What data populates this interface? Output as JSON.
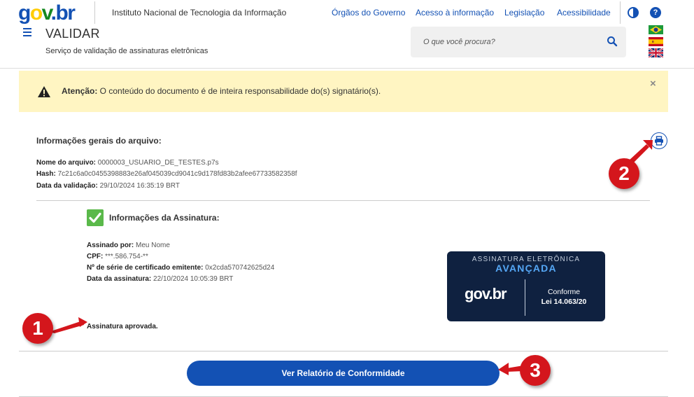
{
  "header": {
    "logo_text": "gov.br",
    "org_name": "Instituto Nacional de Tecnologia da Informação",
    "links": [
      "Órgãos do Governo",
      "Acesso à informação",
      "Legislação",
      "Acessibilidade"
    ],
    "app_title": "VALIDAR",
    "app_subtitle": "Serviço de validação de assinaturas eletrônicas",
    "search_placeholder": "O que você procura?",
    "help_glyph": "?"
  },
  "alert": {
    "label": "Atenção:",
    "text": " O conteúdo do documento é de inteira responsabilidade do(s) signatário(s).",
    "close": "×"
  },
  "file_info": {
    "title": "Informações gerais do arquivo:",
    "fields": [
      {
        "key": "Nome do arquivo:",
        "value": "0000003_USUARIO_DE_TESTES.p7s"
      },
      {
        "key": "Hash:",
        "value": "7c21c6a0c0455398883e26af045039cd9041c9d178fd83b2afee67733582358f"
      },
      {
        "key": "Data da validação:",
        "value": "29/10/2024 16:35:19 BRT"
      }
    ]
  },
  "signature": {
    "title": "Informações da Assinatura:",
    "fields": [
      {
        "key": "Assinado por:",
        "value": "Meu Nome"
      },
      {
        "key": "CPF:",
        "value": "***.586.754-**"
      },
      {
        "key": "Nº de série de certificado emitente:",
        "value": "0x2cda570742625d24"
      },
      {
        "key": "Data da assinatura:",
        "value": "22/10/2024 10:05:39 BRT"
      }
    ],
    "status": "Assinatura aprovada.",
    "badge": {
      "line1": "ASSINATURA ELETRÔNICA",
      "line2": "AVANÇADA",
      "logo": "gov.br",
      "conformity": "Conforme",
      "law": "Lei 14.063/20"
    }
  },
  "actions": {
    "report_button": "Ver Relatório de Conformidade"
  },
  "annotations": [
    "1",
    "2",
    "3"
  ],
  "colors": {
    "primary": "#1351b4",
    "alert_bg": "#fff5c2",
    "badge_bg": "#0f2140",
    "annotation": "#d4161c",
    "success": "#5ab94a"
  }
}
